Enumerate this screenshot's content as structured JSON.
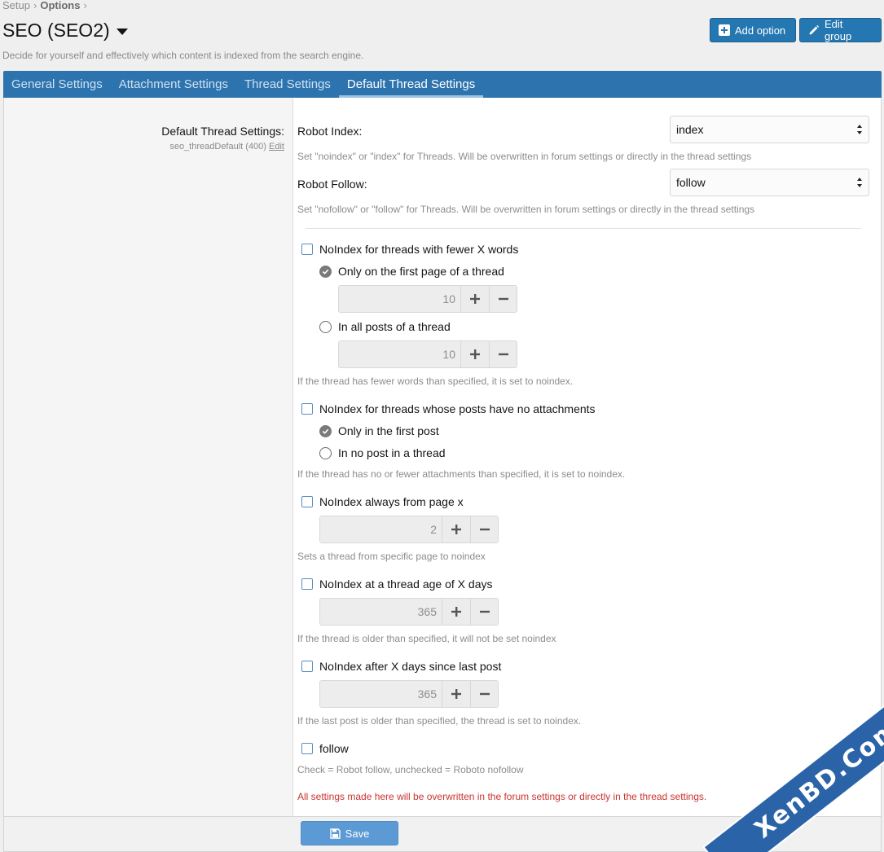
{
  "breadcrumb": {
    "items": [
      "Setup",
      "Options"
    ],
    "separator": "›"
  },
  "page": {
    "title": "SEO (SEO2)",
    "description": "Decide for yourself and effectively which content is indexed from the search engine."
  },
  "header_buttons": {
    "add_option": "Add option",
    "edit_group": "Edit group"
  },
  "tabs": [
    {
      "label": "General Settings",
      "active": false
    },
    {
      "label": "Attachment Settings",
      "active": false
    },
    {
      "label": "Thread Settings",
      "active": false
    },
    {
      "label": "Default Thread Settings",
      "active": true
    }
  ],
  "option": {
    "label": "Default Thread Settings:",
    "sub": "seo_threadDefault (400)",
    "edit_link": "Edit"
  },
  "robot_index": {
    "label": "Robot Index:",
    "value": "index",
    "hint": "Set \"noindex\" or \"index\" for Threads. Will be overwritten in forum settings or directly in the thread settings"
  },
  "robot_follow": {
    "label": "Robot Follow:",
    "value": "follow",
    "hint": "Set \"nofollow\" or \"follow\" for Threads. Will be overwritten in forum settings or directly in the thread settings"
  },
  "fewer_words": {
    "label": "NoIndex for threads with fewer X words",
    "checked": false,
    "opt_first": "Only on the first page of a thread",
    "first_value": "10",
    "opt_all": "In all posts of a thread",
    "all_value": "10",
    "hint": "If the thread has fewer words than specified, it is set to noindex."
  },
  "no_attachments": {
    "label": "NoIndex for threads whose posts have no attachments",
    "checked": false,
    "opt_first": "Only in the first post",
    "opt_none": "In no post in a thread",
    "hint": "If the thread has no or fewer attachments than specified, it is set to noindex."
  },
  "from_page": {
    "label": "NoIndex always from page x",
    "checked": false,
    "value": "2",
    "hint": "Sets a thread from specific page to noindex"
  },
  "thread_age": {
    "label": "NoIndex at a thread age of X days",
    "checked": false,
    "value": "365",
    "hint": "If the thread is older than specified, it will not be set noindex"
  },
  "last_post": {
    "label": "NoIndex after X days since last post",
    "checked": false,
    "value": "365",
    "hint": "If the last post is older than specified, the thread is set to noindex."
  },
  "follow": {
    "label": "follow",
    "checked": false,
    "hint": "Check = Robot follow, unchecked = Roboto nofollow"
  },
  "warning": "All settings made here will be overwritten in the forum settings or directly in the thread settings.",
  "save_label": "Save",
  "watermark": "XenBD.Com",
  "colors": {
    "accent": "#2577b1",
    "tab_bar": "#2d73ad",
    "warning": "#c8342f",
    "save": "#5b9ad4"
  }
}
